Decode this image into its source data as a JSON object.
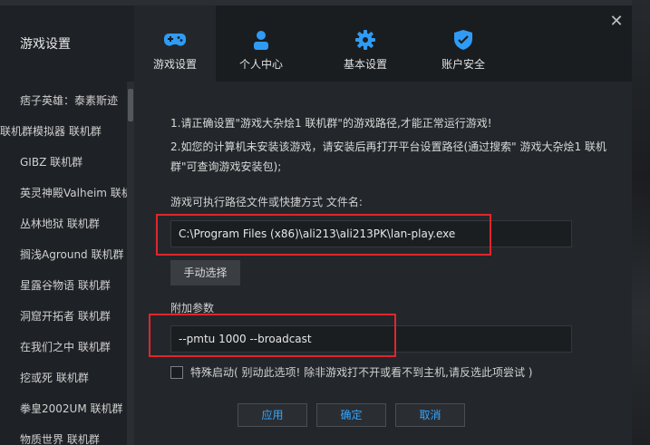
{
  "sidebar": {
    "title": "游戏设置",
    "items": [
      {
        "label": "痞子英雄：泰素斯迹"
      },
      {
        "label": "联机群模拟器 联机群"
      },
      {
        "label": "GIBZ 联机群"
      },
      {
        "label": "英灵神殿Valheim 联机"
      },
      {
        "label": "丛林地狱 联机群"
      },
      {
        "label": "搁浅Aground 联机群"
      },
      {
        "label": "星露谷物语 联机群"
      },
      {
        "label": "洞窟开拓者 联机群"
      },
      {
        "label": "在我们之中 联机群"
      },
      {
        "label": "挖或死 联机群"
      },
      {
        "label": "拳皇2002UM 联机群"
      },
      {
        "label": "物质世界 联机群"
      }
    ]
  },
  "tabs": [
    {
      "label": "游戏设置",
      "icon": "gamepad-icon",
      "active": true
    },
    {
      "label": "个人中心",
      "icon": "user-icon",
      "active": false
    },
    {
      "label": "基本设置",
      "icon": "gear-icon",
      "active": false
    },
    {
      "label": "账户安全",
      "icon": "shield-icon",
      "active": false
    }
  ],
  "content": {
    "note1": "1.请正确设置\"游戏大杂烩1 联机群\"的游戏路径,才能正常运行游戏!",
    "note2": "2.如您的计算机未安装该游戏，请安装后再打开平台设置路径(通过搜索\" 游戏大杂烩1 联机",
    "note3": "群\"可查询游戏安装包);",
    "path_label": "游戏可执行路径文件或快捷方式 文件名:",
    "path_value": "C:\\Program Files (x86)\\ali213\\ali213PK\\lan-play.exe",
    "manual_button": "手动选择",
    "params_label": "附加参数",
    "params_value": "--pmtu 1000 --broadcast",
    "special_label": "特殊启动( 别动此选项! 除非游戏打不开或看不到主机,请反选此项尝试 )",
    "special_checked": false
  },
  "buttons": {
    "apply": "应用",
    "ok": "确定",
    "cancel": "取消"
  },
  "colors": {
    "accent": "#35a6ff",
    "highlight": "#e0262b"
  }
}
